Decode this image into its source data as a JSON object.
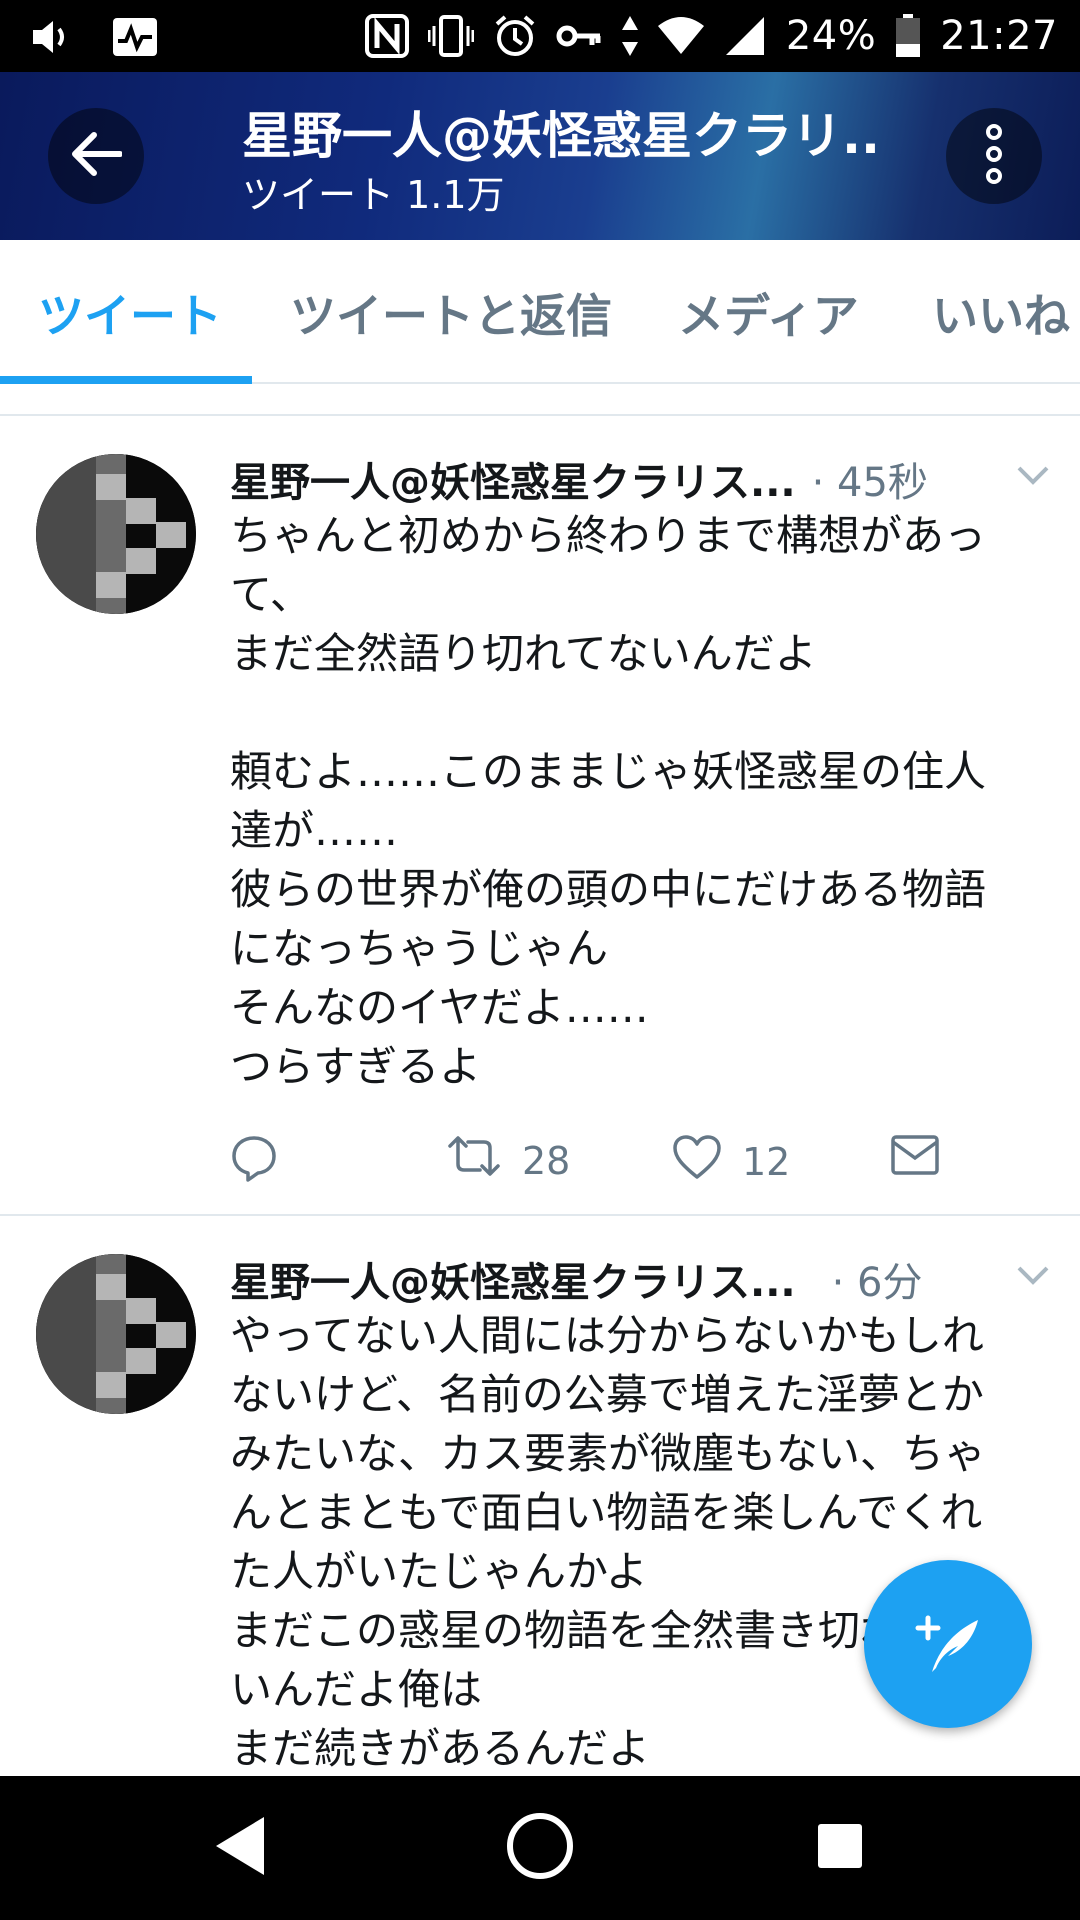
{
  "status_bar": {
    "battery": "24%",
    "time": "21:27",
    "icons": [
      "volume-icon",
      "activity-icon",
      "nfc-icon",
      "vibrate-icon",
      "alarm-icon",
      "key-icon",
      "data-arrows-icon",
      "wifi-icon",
      "signal-icon",
      "battery-icon"
    ]
  },
  "header": {
    "name": "星野一人@妖怪惑星クラリ..",
    "tweet_count": "ツイート 1.1万",
    "colors": {
      "bg_dark": "#0a1a5c",
      "bg_light": "#2a6fa5"
    }
  },
  "tabs": [
    {
      "label": "ツイート",
      "active": true
    },
    {
      "label": "ツイートと返信",
      "active": false
    },
    {
      "label": "メディア",
      "active": false
    },
    {
      "label": "いいね",
      "active": false
    }
  ],
  "tweets": [
    {
      "name": "星野一人@妖怪惑星クラリス...",
      "time": "· 45秒",
      "lines": [
        "ちゃんと初めから終わりまで構想があっ",
        "て、",
        "まだ全然語り切れてないんだよ",
        "",
        "頼むよ……このままじゃ妖怪惑星の住人",
        "達が……",
        "彼らの世界が俺の頭の中にだけある物語",
        "になっちゃうじゃん",
        "そんなのイヤだよ……",
        "つらすぎるよ"
      ],
      "retweets": "28",
      "likes": "12"
    },
    {
      "name": "星野一人@妖怪惑星クラリス...",
      "time": "· 6分",
      "lines": [
        "やってない人間には分からないかもしれ",
        "ないけど、名前の公募で増えた淫夢とか",
        "みたいな、カス要素が微塵もない、ちゃ",
        "んとまともで面白い物語を楽しんでくれ",
        "た人がいたじゃんかよ",
        "まだこの惑星の物語を全然書き切れてな",
        "いんだよ俺は",
        "まだ続きがあるんだよ"
      ]
    }
  ],
  "accent_color": "#1da1f2"
}
